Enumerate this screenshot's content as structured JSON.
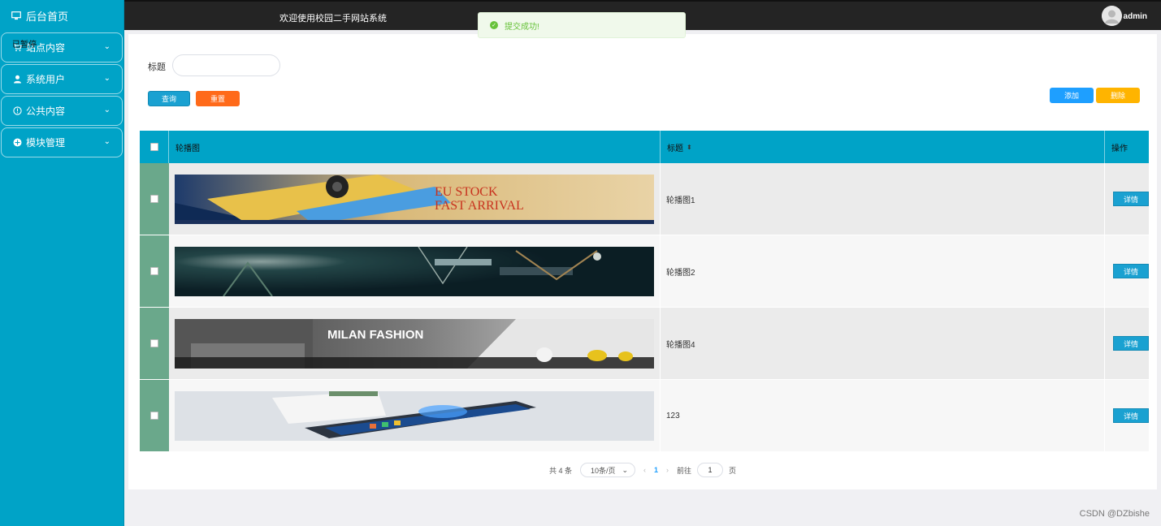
{
  "sidebar": {
    "home": "后台首页",
    "paused_overlay": "已暂停",
    "items": [
      {
        "label": "站点内容",
        "icon": "cart-icon"
      },
      {
        "label": "系统用户",
        "icon": "user-icon"
      },
      {
        "label": "公共内容",
        "icon": "info-icon"
      },
      {
        "label": "模块管理",
        "icon": "plus-circle-icon"
      }
    ]
  },
  "header": {
    "welcome": "欢迎使用校园二手网站系统",
    "username": "admin"
  },
  "toast": {
    "message": "提交成功!",
    "color": "#67c23a"
  },
  "search": {
    "label": "标题",
    "value": "",
    "query_button": "查询",
    "reset_button": "重置"
  },
  "actions": {
    "add_button": "添加",
    "delete_button": "删除"
  },
  "table": {
    "headers": {
      "image": "轮播图",
      "title": "标题",
      "ops": "操作"
    },
    "rows": [
      {
        "title": "轮播图1",
        "image": "banner-phone-eu-stock",
        "banner_text": "EU STOCK FAST ARRIVAL",
        "detail": "详情"
      },
      {
        "title": "轮播图2",
        "image": "banner-forest-swing",
        "banner_text": "",
        "detail": "详情"
      },
      {
        "title": "轮播图4",
        "image": "banner-milan-fashion-kitchen",
        "banner_text": "MILAN FASHION",
        "detail": "详情"
      },
      {
        "title": "123",
        "image": "banner-smartphone-desk",
        "banner_text": "",
        "detail": "详情"
      }
    ]
  },
  "pagination": {
    "total": "共 4 条",
    "page_size": "10条/页",
    "current_page": "1",
    "goto_label": "前往",
    "goto_value": "1",
    "page_suffix": "页"
  },
  "watermark": "CSDN @DZbishe",
  "colors": {
    "sidebar": "#00a3c7",
    "topbar": "#242424",
    "reset": "#ff6a1a",
    "add": "#1e9fff",
    "delete": "#ffb400"
  }
}
